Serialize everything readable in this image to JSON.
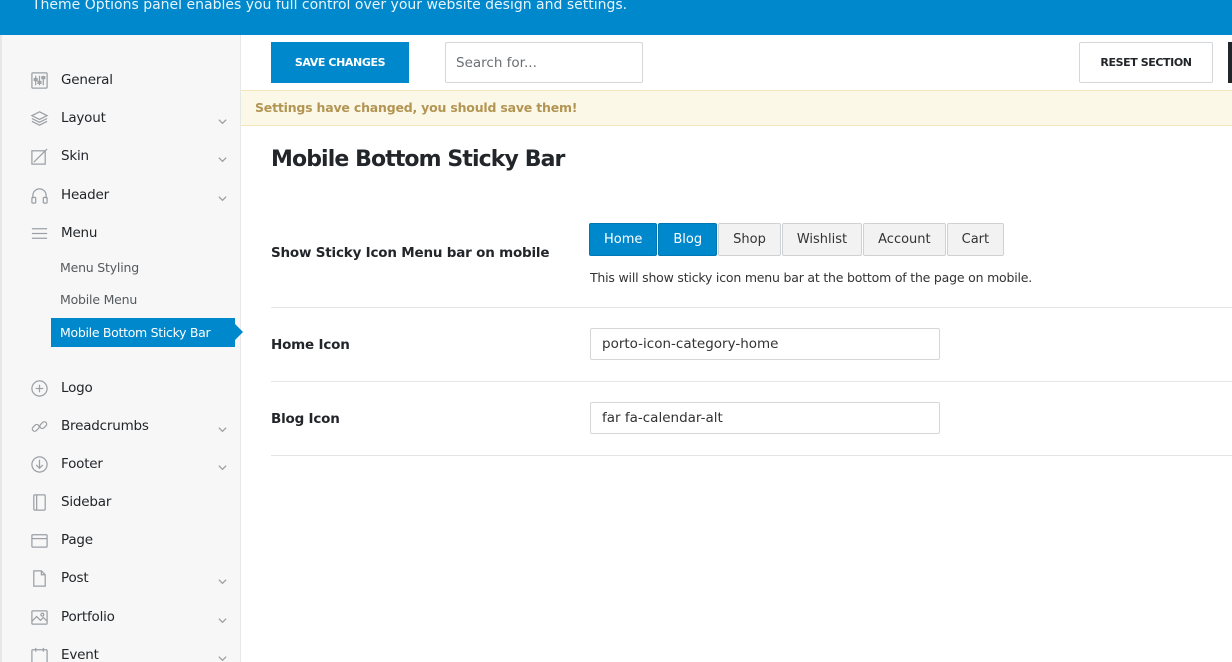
{
  "banner": {
    "text": "Theme Options panel enables you full control over your website design and settings."
  },
  "toolbar": {
    "save_label": "SAVE CHANGES",
    "search_placeholder": "Search for...",
    "reset_label": "RESET SECTION"
  },
  "notice": {
    "text": "Settings have changed, you should save them!"
  },
  "sidebar": {
    "items": [
      {
        "label": "General",
        "icon": "sliders-icon",
        "has_children": false
      },
      {
        "label": "Layout",
        "icon": "layers-icon",
        "has_children": true
      },
      {
        "label": "Skin",
        "icon": "paint-icon",
        "has_children": true
      },
      {
        "label": "Header",
        "icon": "headphones-icon",
        "has_children": true
      },
      {
        "label": "Menu",
        "icon": "hamburger-icon",
        "has_children": false
      },
      {
        "label": "Logo",
        "icon": "plus-circle-icon",
        "has_children": false
      },
      {
        "label": "Breadcrumbs",
        "icon": "link-icon",
        "has_children": true
      },
      {
        "label": "Footer",
        "icon": "arrow-down-circle-icon",
        "has_children": true
      },
      {
        "label": "Sidebar",
        "icon": "notebook-icon",
        "has_children": false
      },
      {
        "label": "Page",
        "icon": "window-icon",
        "has_children": false
      },
      {
        "label": "Post",
        "icon": "document-icon",
        "has_children": true
      },
      {
        "label": "Portfolio",
        "icon": "image-icon",
        "has_children": true
      },
      {
        "label": "Event",
        "icon": "calendar-icon",
        "has_children": true
      }
    ],
    "menu_sub": [
      {
        "label": "Menu Styling"
      },
      {
        "label": "Mobile Menu"
      },
      {
        "label": "Mobile Bottom Sticky Bar",
        "active": true
      }
    ]
  },
  "main": {
    "title": "Mobile Bottom Sticky Bar",
    "sticky": {
      "label": "Show Sticky Icon Menu bar on mobile",
      "options": [
        {
          "label": "Home",
          "selected": true
        },
        {
          "label": "Blog",
          "selected": true
        },
        {
          "label": "Shop",
          "selected": false
        },
        {
          "label": "Wishlist",
          "selected": false
        },
        {
          "label": "Account",
          "selected": false
        },
        {
          "label": "Cart",
          "selected": false
        }
      ],
      "description": "This will show sticky icon menu bar at the bottom of the page on mobile."
    },
    "home_icon": {
      "label": "Home Icon",
      "value": "porto-icon-category-home"
    },
    "blog_icon": {
      "label": "Blog Icon",
      "value": "far fa-calendar-alt"
    }
  },
  "colors": {
    "accent": "#0088cc",
    "notice_bg": "#fcf8e8",
    "notice_text": "#b39553"
  }
}
